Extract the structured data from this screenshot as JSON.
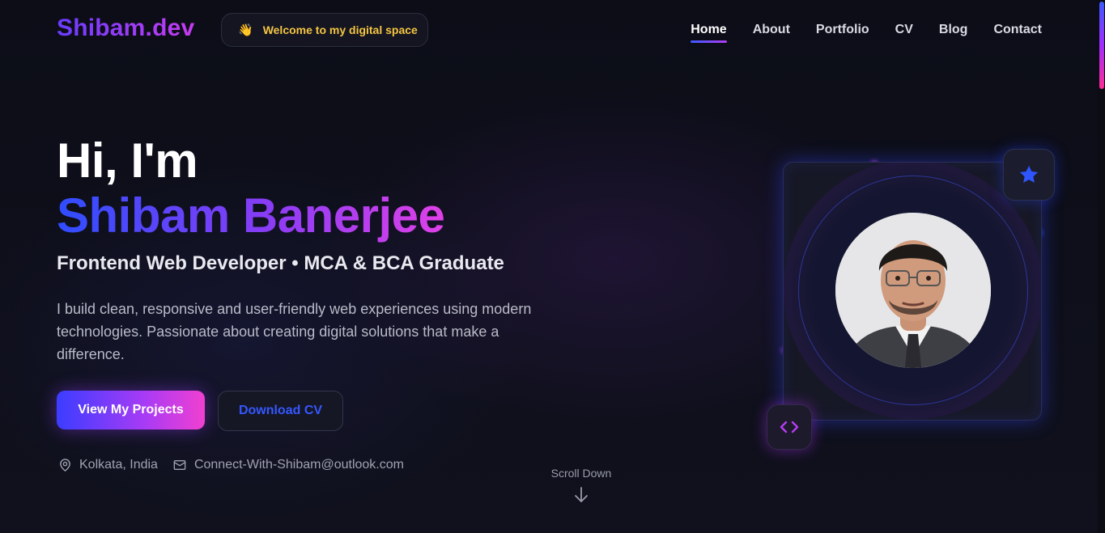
{
  "header": {
    "logo": "Shibam.dev",
    "welcome_text": "Welcome to my digital space",
    "nav": [
      {
        "label": "Home",
        "active": true
      },
      {
        "label": "About",
        "active": false
      },
      {
        "label": "Portfolio",
        "active": false
      },
      {
        "label": "CV",
        "active": false
      },
      {
        "label": "Blog",
        "active": false
      },
      {
        "label": "Contact",
        "active": false
      }
    ]
  },
  "hero": {
    "greeting": "Hi, I'm",
    "name": "Shibam Banerjee",
    "subtitle": "Frontend Web Developer • MCA & BCA Graduate",
    "description": "I build clean, responsive and user-friendly web experiences using modern technologies. Passionate about creating digital solutions that make a difference.",
    "primary_button": "View My Projects",
    "secondary_button": "Download CV",
    "location": "Kolkata, India",
    "email": "Connect-With-Shibam@outlook.com",
    "scroll_label": "Scroll Down"
  },
  "icons": {
    "wave": "waving-hand-icon",
    "location": "map-pin-icon",
    "email": "mail-icon",
    "scroll": "arrow-down-icon",
    "star": "star-icon",
    "code": "code-brackets-icon"
  },
  "colors": {
    "accent_blue": "#3457ff",
    "accent_purple": "#a93bf5",
    "accent_pink": "#f040d0",
    "welcome_yellow": "#f5c542",
    "background": "#0e0f1a"
  }
}
